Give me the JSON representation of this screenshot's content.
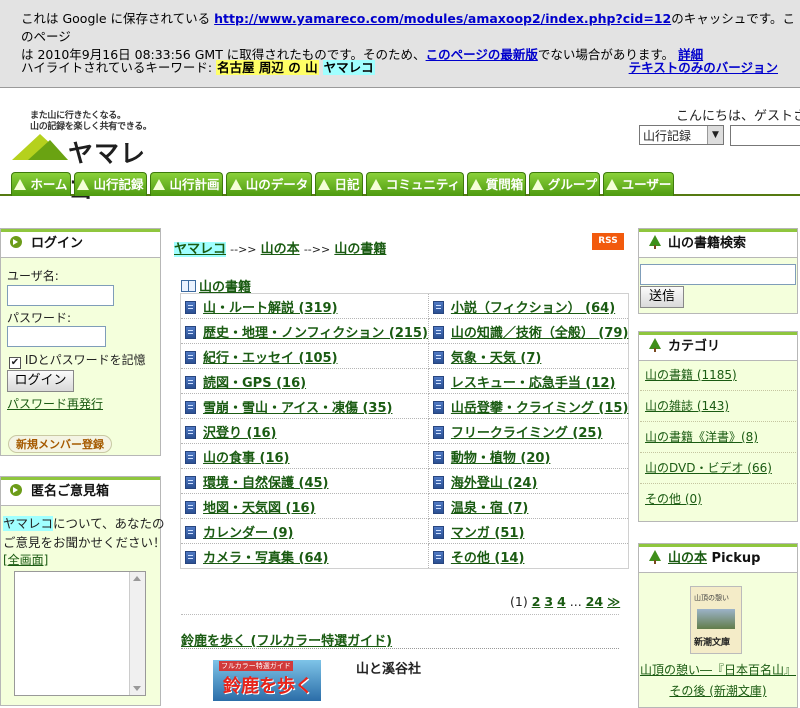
{
  "cache": {
    "line1_pre": "これは Google に保存されている",
    "url": "http://www.yamareco.com/modules/amaxoop2/index.php?cid=12",
    "line1_post": "のキャッシュです。このページ",
    "line2_pre": "は 2010年9月16日 08:33:56 GMT に取得されたものです。そのため、",
    "latest_link": "このページの最新版",
    "line2_post": "でない場合があります。",
    "detail_link": "詳細",
    "kw_label": "ハイライトされているキーワード:",
    "kw1": "名古屋 周辺 の 山",
    "kw2": "ヤマレコ",
    "textonly": "テキストのみのバージョン"
  },
  "header": {
    "tagline1": "また山に行きたくなる。",
    "tagline2": "山の記録を楽しく共有できる。",
    "logo": "ヤマレコ",
    "greeting": "こんにちは、ゲストさん",
    "search_select": "山行記録"
  },
  "nav": [
    "ホーム",
    "山行記録",
    "山行計画",
    "山のデータ",
    "日記",
    "コミュニティ",
    "質問箱",
    "グループ",
    "ユーザー"
  ],
  "login": {
    "title": "ログイン",
    "user_label": "ユーザ名:",
    "pass_label": "パスワード:",
    "remember": "IDとパスワードを記憶",
    "button": "ログイン",
    "reissue": "パスワード再発行",
    "signup": "新規メンバー登録"
  },
  "feedback": {
    "title": "匿名ご意見箱",
    "highlight": "ヤマレコ",
    "text1": "について、あなたの",
    "text2": "ご意見をお聞かせください！",
    "fullscreen": "[全画面]"
  },
  "breadcrumb": {
    "root": "ヤマレコ",
    "sep": "-->>",
    "mid": "山の本",
    "current": "山の書籍"
  },
  "rss": "RSS",
  "section_title": "山の書籍",
  "categories": [
    [
      "山・ルート解説 (319)",
      "小説（フィクション） (64)"
    ],
    [
      "歴史・地理・ノンフィクション (215)",
      "山の知識／技術（全般） (79)"
    ],
    [
      "紀行・エッセイ (105)",
      "気象・天気 (7)"
    ],
    [
      "読図・GPS (16)",
      "レスキュー・応急手当 (12)"
    ],
    [
      "雪崩・雪山・アイス・凍傷 (35)",
      "山岳登攀・クライミング (15)"
    ],
    [
      "沢登り (16)",
      "フリークライミング (25)"
    ],
    [
      "山の食事 (16)",
      "動物・植物 (20)"
    ],
    [
      "環境・自然保護 (45)",
      "海外登山 (24)"
    ],
    [
      "地図・天気図 (16)",
      "温泉・宿 (7)"
    ],
    [
      "カレンダー (9)",
      "マンガ (51)"
    ],
    [
      "カメラ・写真集 (64)",
      "その他 (14)"
    ]
  ],
  "pager": {
    "current": "(1)",
    "pages": [
      "2",
      "3",
      "4"
    ],
    "ellipsis": "...",
    "last": "24",
    "next": "≫"
  },
  "featured": {
    "title": "鈴鹿を歩く (フルカラー特選ガイド)",
    "publisher": "山と溪谷社",
    "cover_small": "フルカラー特選ガイド",
    "cover_big": "鈴鹿を歩く"
  },
  "booksearch": {
    "title": "山の書籍検索",
    "button": "送信"
  },
  "category_box": {
    "title": "カテゴリ",
    "items": [
      "山の書籍 (1185)",
      "山の雑誌 (143)",
      "山の書籍《洋書》(8)",
      "山のDVD・ビデオ (66)",
      "その他 (0)"
    ]
  },
  "pickup": {
    "title_link": "山の本",
    "title_rest": " Pickup",
    "cover_title": "山頂の憩い",
    "cover_bottom": "新潮文庫",
    "line1": "山頂の憩い―『日本百名山』",
    "line2": "その後 (新潮文庫)"
  }
}
